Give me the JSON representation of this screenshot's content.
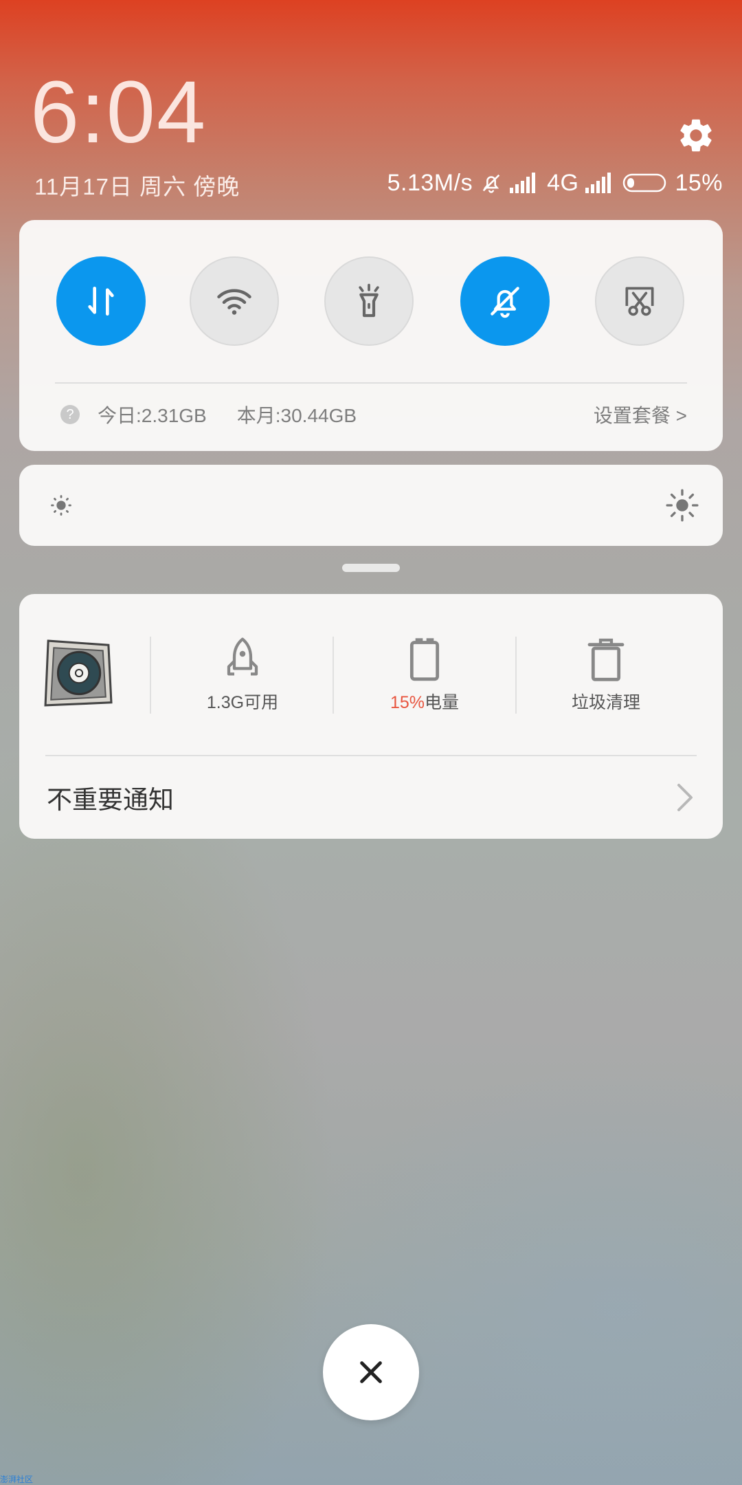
{
  "status_bar": {
    "time": "6:04",
    "date": "11月17日 周六 傍晚",
    "speed": "5.13M/s",
    "network": "4G",
    "battery_percent": "15%"
  },
  "quick_settings": {
    "toggles": [
      {
        "name": "mobile-data",
        "icon": "data-transfer-icon",
        "state": "on"
      },
      {
        "name": "wifi",
        "icon": "wifi-icon",
        "state": "off"
      },
      {
        "name": "flashlight",
        "icon": "flashlight-icon",
        "state": "off"
      },
      {
        "name": "silent",
        "icon": "bell-off-icon",
        "state": "on"
      },
      {
        "name": "screenshot",
        "icon": "scissors-icon",
        "state": "off"
      }
    ],
    "today_usage": "今日:2.31GB",
    "month_usage": "本月:30.44GB",
    "plan_link": "设置套餐 >"
  },
  "brightness": {
    "level": 0.0
  },
  "tools": {
    "memory": "1.3G可用",
    "battery_value": "15%",
    "battery_suffix": "电量",
    "cleanup": "垃圾清理"
  },
  "notifications": {
    "unimportant_label": "不重要通知"
  },
  "watermark": "澎湃社区",
  "colors": {
    "accent": "#0b97ee",
    "battery_low": "#e8553f"
  }
}
